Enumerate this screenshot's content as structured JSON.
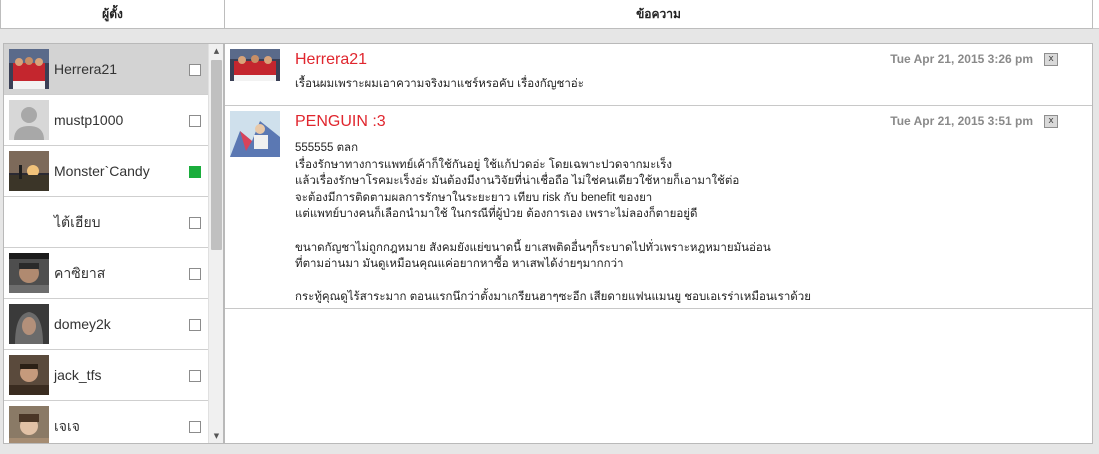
{
  "header": {
    "poster_label": "ผู้ตั้ง",
    "message_label": "ข้อความ"
  },
  "users": [
    {
      "name": "Herrera21",
      "checked": false,
      "selected": true,
      "avatar": "soccer-team-photo"
    },
    {
      "name": "mustp1000",
      "checked": false,
      "selected": false,
      "avatar": "default-silhouette"
    },
    {
      "name": "Monster`Candy",
      "checked": true,
      "selected": false,
      "avatar": "sunset-photo"
    },
    {
      "name": "ไต้เฮียบ",
      "checked": false,
      "selected": false,
      "avatar": "none"
    },
    {
      "name": "คาซิยาส",
      "checked": false,
      "selected": false,
      "avatar": "person-photo"
    },
    {
      "name": "domey2k",
      "checked": false,
      "selected": false,
      "avatar": "hooded-person-photo"
    },
    {
      "name": "jack_tfs",
      "checked": false,
      "selected": false,
      "avatar": "person-photo"
    },
    {
      "name": "เจเจ",
      "checked": false,
      "selected": false,
      "avatar": "person-photo"
    }
  ],
  "messages": [
    {
      "author": "Herrera21",
      "time": "Tue Apr 21, 2015 3:26 pm",
      "close_label": "x",
      "body": "เรื้อนผมเพราะผมเอาความจริงมาแชร์หรอคับ เรื่องกัญชาอ่ะ"
    },
    {
      "author": "PENGUIN :3",
      "time": "Tue Apr 21, 2015 3:51 pm",
      "close_label": "x",
      "body": "555555 ตลก\nเรื่องรักษาทางการแพทย์เค้าก็ใช้กันอยู่ ใช้แก้ปวดอ่ะ โดยเฉพาะปวดจากมะเร็ง\nแล้วเรื่องรักษาโรคมะเร็งอ่ะ มันต้องมีงานวิจัยที่น่าเชื่อถือ ไม่ใช่คนเดียวใช้หายก็เอามาใช้ต่อ\nจะต้องมีการติดตามผลการรักษาในระยะยาว เทียบ risk กับ benefit ของยา\nแต่แพทย์บางคนก็เลือกนำมาใช้ ในกรณีที่ผู้ป่วย ต้องการเอง เพราะไม่ลองก็ตายอยู่ดี\n\nขนาดกัญชาไม่ถูกกฎหมาย สังคมยังแย่ขนาดนี้ ยาเสพติดอื่นๆก็ระบาดไปทั่วเพราะหฎหมายมันอ่อน\nที่ตามอ่านมา มันดูเหมือนคุณแค่อยากหาซื้อ หาเสพได้ง่ายๆมากกว่า\n\nกระทู้คุณดูไร้สาระมาก ตอนแรกนึกว่าตั้งมาเกรียนฮาๆซะอีก เสียดายแฟนแมนยู ชอบเอเรร่าเหมือนเราด้วย"
    }
  ],
  "colors": {
    "author": "#e0262e",
    "checkbox_on": "#1aad3c",
    "selected_row": "#d3d3d3"
  }
}
